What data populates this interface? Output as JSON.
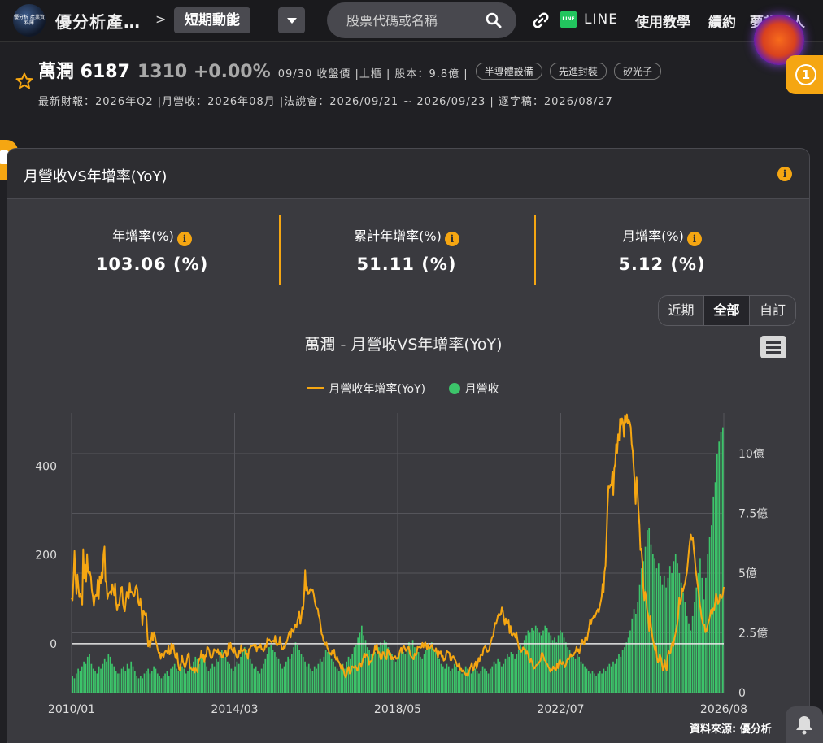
{
  "app": {
    "title": "優分析產…",
    "logo_text": "優分析 產業資料庫",
    "crumb_sep": ">",
    "crumb": "短期動能"
  },
  "search": {
    "placeholder": "股票代碼或名稱"
  },
  "nav": {
    "line": "LINE",
    "tutorial": "使用教學",
    "renew": "續約",
    "member": "夢想達人"
  },
  "stock": {
    "name": "萬潤 6187",
    "price": "1310 +0.00%",
    "meta": "09/30 收盤價 |上櫃 | 股本：9.8億 |",
    "tags": [
      "半導體設備",
      "先進封裝",
      "矽光子"
    ],
    "sub": "最新財報：2026年Q2 |月營收：2026年08月 |法說會：2026/09/21 ~ 2026/09/23 | 逐字稿：2026/08/27"
  },
  "notif_count": "1",
  "card": {
    "title": "月營收VS年增率(YoY)",
    "stats": [
      {
        "label": "年增率(%)",
        "value": "103.06 (%)"
      },
      {
        "label": "累計年增率(%)",
        "value": "51.11 (%)"
      },
      {
        "label": "月增率(%)",
        "value": "5.12 (%)"
      }
    ],
    "ranges": [
      "近期",
      "全部",
      "自訂"
    ],
    "active_range": "全部"
  },
  "colors": {
    "accent": "#f5a612",
    "bar": "#3cc46a",
    "line": "#f5a612"
  },
  "chart_data": {
    "type": "bar+line",
    "title": "萬潤 - 月營收VS年增率(YoY)",
    "legend": [
      "月營收年增率(YoY)",
      "月營收"
    ],
    "x_start": "2010/01",
    "x_end": "2026/08",
    "xticks": [
      "2010/01",
      "2014/03",
      "2018/05",
      "2022/07",
      "2026/08"
    ],
    "y_left": {
      "ticks": [
        "0",
        "200",
        "400"
      ],
      "ylim": [
        -110,
        520
      ]
    },
    "y_right": {
      "ticks": [
        "0",
        "2.5億",
        "5億",
        "7.5億",
        "10億"
      ],
      "ylim": [
        0,
        11.7
      ]
    },
    "series": [
      {
        "name": "月營收年增率(YoY)",
        "axis": "left",
        "unit": "%",
        "values": [
          103,
          98,
          148,
          209,
          152,
          112,
          156,
          131,
          105,
          113,
          101,
          88,
          213,
          148,
          178,
          140,
          202,
          162,
          158,
          161,
          150,
          120,
          107,
          85,
          106,
          110,
          108,
          145,
          101,
          152,
          136,
          160,
          148,
          202,
          219,
          141,
          138,
          101,
          112,
          115,
          118,
          111,
          134,
          124,
          109,
          136,
          94,
          75,
          88,
          86,
          106,
          126,
          128,
          91,
          80,
          73,
          96,
          117,
          105,
          102,
          137,
          115,
          117,
          113,
          106,
          110,
          127,
          131,
          121,
          92,
          86,
          101,
          82,
          42,
          74,
          71,
          64,
          69,
          28,
          -6,
          7,
          -8,
          8,
          24,
          7,
          26,
          19,
          5,
          -3,
          -14,
          -21,
          -20,
          -34,
          -22,
          -26,
          -30,
          -20,
          -16,
          -17,
          -21,
          -4,
          -24,
          -22,
          0,
          -11,
          -2,
          -18,
          -29,
          -34,
          -21,
          -45,
          -58,
          -59,
          -41,
          -27,
          -40,
          -47,
          -54,
          -47,
          -37,
          -24,
          -21,
          -53,
          -56,
          -57,
          -60,
          -54,
          -65,
          -55,
          -61,
          -64,
          -41,
          -34,
          -31,
          -15,
          -33,
          -24,
          -40,
          -26,
          -28,
          -7,
          -9,
          -14,
          -27,
          -33,
          -31,
          -23,
          -12,
          -14,
          -17,
          -19,
          -12,
          -24,
          -19,
          -21,
          -31,
          -31,
          -22,
          -18,
          -15,
          -28,
          -25,
          1,
          -10,
          2,
          -11,
          -16,
          -20,
          -9,
          -20,
          -28,
          -33,
          -29,
          -15,
          -20,
          -3,
          -17,
          -16,
          -12,
          -13,
          -24,
          -22,
          -34,
          -12,
          -11,
          -5,
          -5,
          -4,
          -2,
          -7,
          -2,
          -17,
          -8,
          -7,
          -8,
          -1,
          -12,
          -12,
          -17,
          -13,
          -3,
          -7,
          12,
          8,
          10,
          6,
          4,
          5,
          7,
          4,
          18,
          1,
          -4,
          0,
          -2,
          16,
          1,
          -12,
          -13,
          -6,
          -10,
          0,
          4,
          12,
          22,
          28,
          14,
          33,
          30,
          26,
          38,
          44,
          37,
          51,
          62,
          72,
          45,
          58,
          82,
          78,
          113,
          166,
          120,
          128,
          112,
          113,
          122,
          124,
          120,
          121,
          110,
          95,
          84,
          80,
          79,
          64,
          57,
          40,
          22,
          19,
          7,
          3,
          -3,
          3,
          -9,
          -13,
          -23,
          -21,
          -25,
          -15,
          -21,
          -13,
          -31,
          -36,
          -29,
          -38,
          -41,
          -47,
          -56,
          -47,
          -55,
          -63,
          -72,
          -76,
          -68,
          -57,
          -52,
          -67,
          -65,
          -51,
          -51,
          -54,
          -52,
          -50,
          -55,
          -61,
          -54,
          -43,
          -44,
          -52,
          -41,
          -33,
          -22,
          -31,
          -23,
          -26,
          -30,
          -47,
          -40,
          -39,
          -38,
          -27,
          -21,
          -5,
          -14,
          -1,
          -20,
          -18,
          -23,
          -35,
          -34,
          -19,
          -19,
          -27,
          -31,
          -35,
          -12,
          -15,
          -25,
          -22,
          -35,
          -30,
          -35,
          -30,
          -28,
          -34,
          -32,
          -34,
          -24,
          -15,
          -9,
          -20,
          -7,
          -5,
          -10,
          -16,
          -13,
          -8,
          -7,
          -20,
          -27,
          -30,
          -33,
          -35,
          -22,
          -26,
          -24,
          -7,
          -8,
          -7,
          -9,
          -8,
          2,
          -8,
          0,
          3,
          -6,
          -13,
          -1,
          -9,
          -10,
          -5,
          -2,
          -13,
          -14,
          -17,
          -10,
          -20,
          -31,
          -17,
          -23,
          -17,
          -29,
          -27,
          -38,
          -36,
          -31,
          -15,
          -18,
          -19,
          -21,
          -37,
          -37,
          -29,
          -28,
          -34,
          -37,
          -43,
          -51,
          -52,
          -43,
          -58,
          -56,
          -63,
          -60,
          -64,
          -67,
          -71,
          -67,
          -73,
          -63,
          -56,
          -50,
          -43,
          -61,
          -58,
          -46,
          -40,
          -55,
          -45,
          -32,
          -39,
          -26,
          -24,
          -26,
          -11,
          -7,
          -5,
          -12,
          -18,
          -17,
          -13,
          -2,
          7,
          16,
          16,
          33,
          47,
          45,
          53,
          64,
          68,
          64,
          67,
          82,
          74,
          58,
          43,
          57,
          47,
          46,
          53,
          24,
          40,
          20,
          19,
          23,
          22,
          14,
          26,
          10,
          -4,
          -13,
          -12,
          -18,
          -15,
          -8,
          -13,
          -12,
          -23,
          -17,
          -24,
          -36,
          -41,
          -34,
          -39,
          -49,
          -56,
          -55,
          -50,
          -47,
          -47,
          -42,
          -40,
          -37,
          -21,
          -21,
          -29,
          -37,
          -39,
          -44,
          -46,
          -52,
          -56,
          -63,
          -58,
          -59,
          -51,
          -56,
          -57,
          -59,
          -44,
          -55,
          -41,
          -36,
          -44,
          -46,
          -41,
          -46,
          -53,
          -48,
          -39,
          -34,
          -35,
          -31,
          -23,
          -28,
          -27,
          -26,
          -20,
          -18,
          -7,
          -17,
          -12,
          -21,
          -9,
          2,
          9,
          2,
          -2,
          15,
          13,
          9,
          25,
          36,
          54,
          44,
          56,
          58,
          63,
          60,
          67,
          73,
          78,
          71,
          84,
          95,
          105,
          135,
          116,
          163,
          176,
          238,
          307,
          355,
          352,
          357,
          357,
          388,
          335,
          395,
          405,
          450,
          430,
          472,
          458,
          507,
          493,
          508,
          498,
          466,
          513,
          499,
          517,
          497,
          504,
          499,
          488,
          449,
          435,
          398,
          362,
          315,
          375,
          343,
          302,
          267,
          211,
          214,
          184,
          126,
          98,
          117,
          100,
          73,
          64,
          29,
          62,
          40,
          22,
          8,
          -3,
          -15,
          -6,
          -31,
          -42,
          -38,
          -24,
          -31,
          -42,
          -60,
          -54,
          -37,
          -53,
          -60,
          -29,
          -16,
          -21,
          -20,
          -5,
          3,
          -5,
          12,
          21,
          33,
          43,
          67,
          104,
          90,
          97,
          125,
          119,
          129,
          136,
          150,
          161,
          185,
          210,
          230,
          246,
          235,
          240,
          213,
          195,
          168,
          150,
          133,
          117,
          95,
          78,
          61,
          48,
          42,
          43,
          26,
          28,
          37,
          48,
          54,
          66,
          77,
          68,
          80,
          75,
          93,
          113,
          103,
          90,
          94,
          110,
          106,
          103,
          111,
          128
        ]
      },
      {
        "name": "月營收",
        "axis": "right",
        "unit": "億",
        "values": [
          0.7,
          0.6,
          0.8,
          1.0,
          0.9,
          1.1,
          1.3,
          1.2,
          1.5,
          1.6,
          1.2,
          1.0,
          0.9,
          0.8,
          1.1,
          1.0,
          1.2,
          1.4,
          1.3,
          1.6,
          1.5,
          1.2,
          1.1,
          0.9,
          0.8,
          0.8,
          1.0,
          1.1,
          0.9,
          1.2,
          1.0,
          1.3,
          1.1,
          0.9,
          0.7,
          0.6,
          0.7,
          0.6,
          0.8,
          0.9,
          1.0,
          0.8,
          0.9,
          1.1,
          1.0,
          0.8,
          0.7,
          0.6,
          0.7,
          0.8,
          0.9,
          0.7,
          1.0,
          1.1,
          1.2,
          1.0,
          0.9,
          1.2,
          1.1,
          1.0,
          0.8,
          0.9,
          1.2,
          1.1,
          1.3,
          1.5,
          1.4,
          1.2,
          1.6,
          1.5,
          1.3,
          1.1,
          0.9,
          1.0,
          1.2,
          1.1,
          1.4,
          1.3,
          1.6,
          1.8,
          1.7,
          1.5,
          1.3,
          1.2,
          1.0,
          0.9,
          1.1,
          1.3,
          1.2,
          1.5,
          1.7,
          1.9,
          1.8,
          1.6,
          1.4,
          1.2,
          1.0,
          1.1,
          0.9,
          0.8,
          1.0,
          1.2,
          1.4,
          1.6,
          1.9,
          2.0,
          1.8,
          1.7,
          1.5,
          1.4,
          1.2,
          1.0,
          1.1,
          1.3,
          1.5,
          1.4,
          1.6,
          1.9,
          2.1,
          2.0,
          1.8,
          1.6,
          1.5,
          1.3,
          1.1,
          1.2,
          1.0,
          0.9,
          1.1,
          1.0,
          1.2,
          1.4,
          1.3,
          1.5,
          1.8,
          1.7,
          1.6,
          1.4,
          1.3,
          1.1,
          1.0,
          0.9,
          1.1,
          1.2,
          1.0,
          1.3,
          1.5,
          1.4,
          1.6,
          1.9,
          2.0,
          2.3,
          2.5,
          2.8,
          2.4,
          2.2,
          1.9,
          1.8,
          1.6,
          1.5,
          1.7,
          1.6,
          1.9,
          2.1,
          2.0,
          2.2,
          2.1,
          1.9,
          1.7,
          1.6,
          1.4,
          1.3,
          1.5,
          1.6,
          1.8,
          1.7,
          1.6,
          1.9,
          2.1,
          2.0,
          2.2,
          1.9,
          1.8,
          1.7,
          1.5,
          1.4,
          1.6,
          1.8,
          2.0,
          1.9,
          2.1,
          1.8,
          1.7,
          1.5,
          1.4,
          1.2,
          1.1,
          1.0,
          1.2,
          1.1,
          0.9,
          1.0,
          1.2,
          1.1,
          0.9,
          1.0,
          0.8,
          0.9,
          1.1,
          1.0,
          0.9,
          0.8,
          0.9,
          1.0,
          0.9,
          0.8,
          0.9,
          1.1,
          1.0,
          0.9,
          0.8,
          1.0,
          1.1,
          1.3,
          1.2,
          1.4,
          1.3,
          1.1,
          1.2,
          1.4,
          1.6,
          1.5,
          1.7,
          1.6,
          1.4,
          1.6,
          1.8,
          2.0,
          1.9,
          2.2,
          2.4,
          2.6,
          2.5,
          2.7,
          2.6,
          2.8,
          2.7,
          2.5,
          2.4,
          2.6,
          2.8,
          2.7,
          2.5,
          2.4,
          2.2,
          2.3,
          2.1,
          2.4,
          2.6,
          2.5,
          2.3,
          2.1,
          1.9,
          1.8,
          1.6,
          1.5,
          1.4,
          1.6,
          1.5,
          1.3,
          1.2,
          1.1,
          1.0,
          0.9,
          0.8,
          0.9,
          0.8,
          0.7,
          0.8,
          0.9,
          0.8,
          1.0,
          0.9,
          1.1,
          1.2,
          1.1,
          1.3,
          1.2,
          1.4,
          1.6,
          1.5,
          1.8,
          1.9,
          2.1,
          2.3,
          2.6,
          3.1,
          3.5,
          3.3,
          3.8,
          4.5,
          5.2,
          5.5,
          6.1,
          6.8,
          6.9,
          6.2,
          5.8,
          5.6,
          5.2,
          5.4,
          4.9,
          4.5,
          4.9,
          4.4,
          4.8,
          5.3,
          5.0,
          5.5,
          5.8,
          5.4,
          5.0,
          4.6,
          4.2,
          3.8,
          3.2,
          2.9,
          2.6,
          3.2,
          3.8,
          4.4,
          5.0,
          5.6,
          4.8,
          3.9,
          4.8,
          5.8,
          6.5,
          7.0,
          8.2,
          8.8,
          10.0,
          10.5,
          10.9,
          11.1
        ]
      }
    ]
  },
  "source": "資料來源: 優分析"
}
